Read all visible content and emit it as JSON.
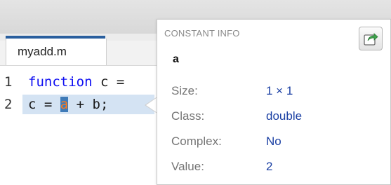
{
  "editor": {
    "tab_label": "myadd.m",
    "lines": [
      {
        "number": "1",
        "keyword": "function",
        "rest": " c ="
      },
      {
        "number": "2",
        "before": "c = ",
        "highlighted": "a",
        "after": " + b;"
      }
    ]
  },
  "constant_info": {
    "title": "CONSTANT INFO",
    "variable": "a",
    "open_button_icon": "open-in-editor-icon",
    "properties": [
      {
        "label": "Size:",
        "value": "1 × 1"
      },
      {
        "label": "Class:",
        "value": "double"
      },
      {
        "label": "Complex:",
        "value": "No"
      },
      {
        "label": "Value:",
        "value": "2"
      }
    ]
  },
  "colors": {
    "keyword": "#0e0ef2",
    "value_text": "#1a3fa3",
    "label_text": "#757575",
    "tab_accent": "#2a5f9e"
  }
}
